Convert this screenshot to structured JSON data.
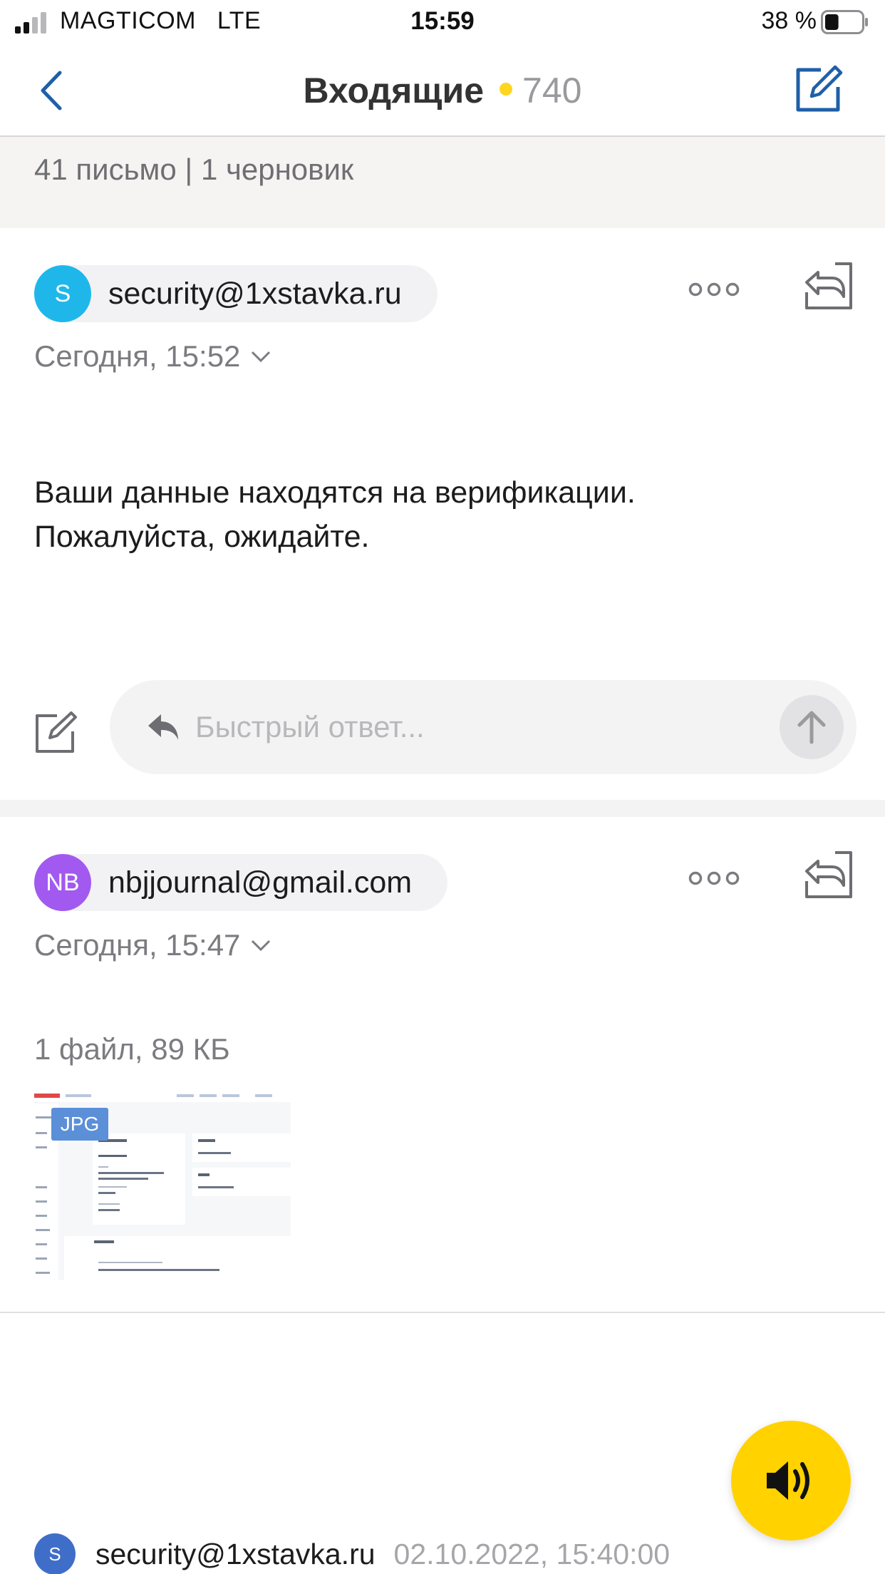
{
  "status_bar": {
    "carrier": "MAGTICOM",
    "network": "LTE",
    "time": "15:59",
    "battery_percent": "38 %",
    "battery_level": 0.38
  },
  "nav": {
    "title": "Входящие",
    "unread_count": "740",
    "back_icon": "chevron-left-icon",
    "compose_icon": "compose-icon",
    "accent_color": "#1f5fa8",
    "unread_dot_color": "#ffd61f"
  },
  "summary": {
    "text": "41 письмо | 1 черновик"
  },
  "messages": [
    {
      "avatar_initials": "S",
      "avatar_color": "#1fb7ea",
      "sender": "security@1xstavka.ru",
      "date": "Сегодня, 15:52",
      "body_line1": "Ваши данные находятся на верификации.",
      "body_line2": "Пожалуйста, ожидайте.",
      "quick_reply_placeholder": "Быстрый ответ..."
    },
    {
      "avatar_initials": "NB",
      "avatar_color": "#a259f0",
      "sender": "nbjjournal@gmail.com",
      "date": "Сегодня, 15:47",
      "files_summary": "1 файл, 89 КБ",
      "attachment_badge": "JPG"
    }
  ],
  "bottom_message": {
    "avatar_initials": "S",
    "sender": "security@1xstavka.ru",
    "date": "02.10.2022, 15:40:00"
  },
  "fab": {
    "icon": "speaker-icon",
    "color": "#ffd200"
  }
}
